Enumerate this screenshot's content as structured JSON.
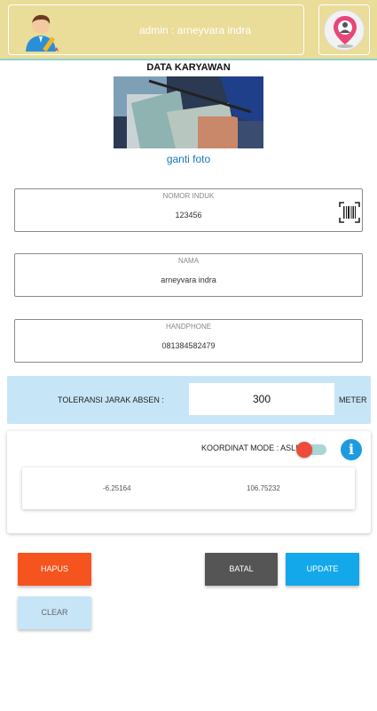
{
  "header": {
    "title": "admin : arneyvara indra",
    "avatar_icon": "user-edit-icon",
    "right_icon": "location-person-icon"
  },
  "section_title": "DATA KARYAWAN",
  "photo": {
    "change_label": "ganti foto"
  },
  "fields": {
    "nomor_induk": {
      "label": "NOMOR INDUK",
      "value": "123456",
      "icon": "barcode-icon"
    },
    "nama": {
      "label": "NAMA",
      "value": "arneyvara indra"
    },
    "handphone": {
      "label": "HANDPHONE",
      "value": "081384582479"
    }
  },
  "tolerance": {
    "label": "TOLERANSI JARAK ABSEN :",
    "value": "300",
    "unit": "METER"
  },
  "coordinates": {
    "mode_label": "KOORDINAT MODE : ASLI",
    "latitude": "-6.25164",
    "longitude": "106.75232",
    "info_icon": "info-icon"
  },
  "buttons": {
    "hapus": "HAPUS",
    "batal": "BATAL",
    "update": "UPDATE",
    "clear": "CLEAR"
  },
  "colors": {
    "header_bg": "#eadc99",
    "accent_blue": "#13a8ea",
    "danger_orange": "#f5541f",
    "neutral_dark": "#555555",
    "light_blue": "#c6e6f8",
    "toggle_knob": "#ee4b3b"
  }
}
